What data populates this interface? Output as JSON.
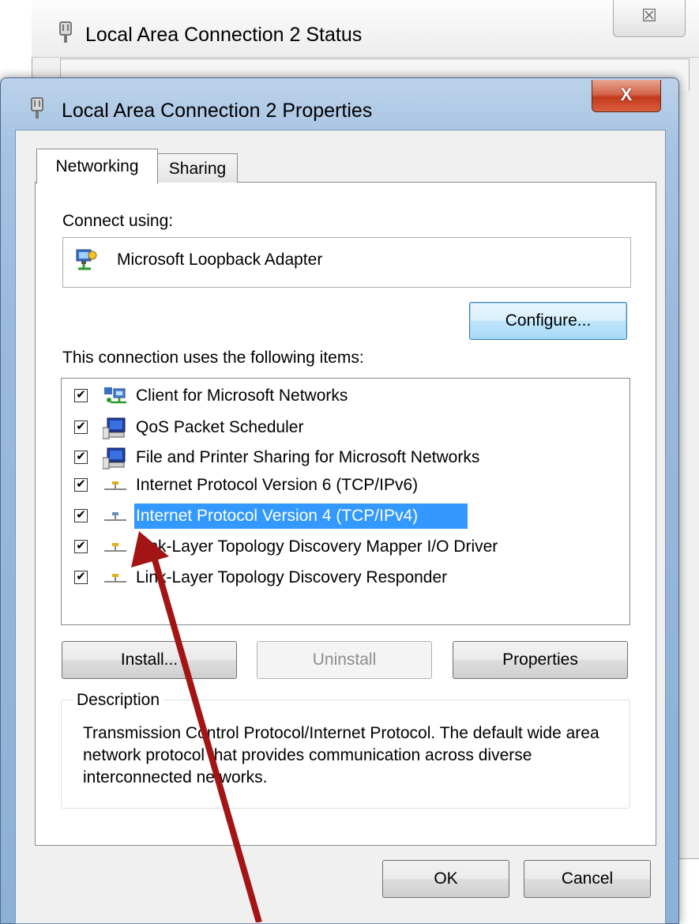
{
  "status_window": {
    "title": "Local Area Connection 2 Status",
    "close_glyph": "☒"
  },
  "properties_dialog": {
    "title": "Local Area Connection 2 Properties",
    "close_glyph": "X",
    "tabs": [
      {
        "label": "Networking",
        "active": true
      },
      {
        "label": "Sharing",
        "active": false
      }
    ],
    "connect_using_label": "Connect using:",
    "adapter_name": "Microsoft Loopback Adapter",
    "configure_label": "Configure...",
    "items_label": "This connection uses the following items:",
    "items": [
      {
        "label": "Client for Microsoft Networks",
        "checked": true,
        "icon": "network-client-icon",
        "selected": false
      },
      {
        "label": "QoS Packet Scheduler",
        "checked": true,
        "icon": "computer-service-icon",
        "selected": false
      },
      {
        "label": "File and Printer Sharing for Microsoft Networks",
        "checked": true,
        "icon": "computer-service-icon",
        "selected": false
      },
      {
        "label": "Internet Protocol Version 6 (TCP/IPv6)",
        "checked": true,
        "icon": "protocol-icon",
        "selected": false
      },
      {
        "label": "Internet Protocol Version 4 (TCP/IPv4)",
        "checked": true,
        "icon": "protocol-icon",
        "selected": true
      },
      {
        "label": "Link-Layer Topology Discovery Mapper I/O Driver",
        "checked": true,
        "icon": "protocol-icon",
        "selected": false
      },
      {
        "label": "Link-Layer Topology Discovery Responder",
        "checked": true,
        "icon": "protocol-icon",
        "selected": false
      }
    ],
    "install_label": "Install...",
    "uninstall_label": "Uninstall",
    "properties_label": "Properties",
    "description_legend": "Description",
    "description_text": "Transmission Control Protocol/Internet Protocol. The default wide area network protocol that provides communication across diverse interconnected networks.",
    "ok_label": "OK",
    "cancel_label": "Cancel"
  },
  "annotation": {
    "arrow_color": "#a31515",
    "arrow_target": "Internet Protocol Version 4 (TCP/IPv4)"
  },
  "colors": {
    "selection": "#3399ff",
    "aero_frame": "#9ab9dc",
    "close_button": "#c4391c"
  }
}
